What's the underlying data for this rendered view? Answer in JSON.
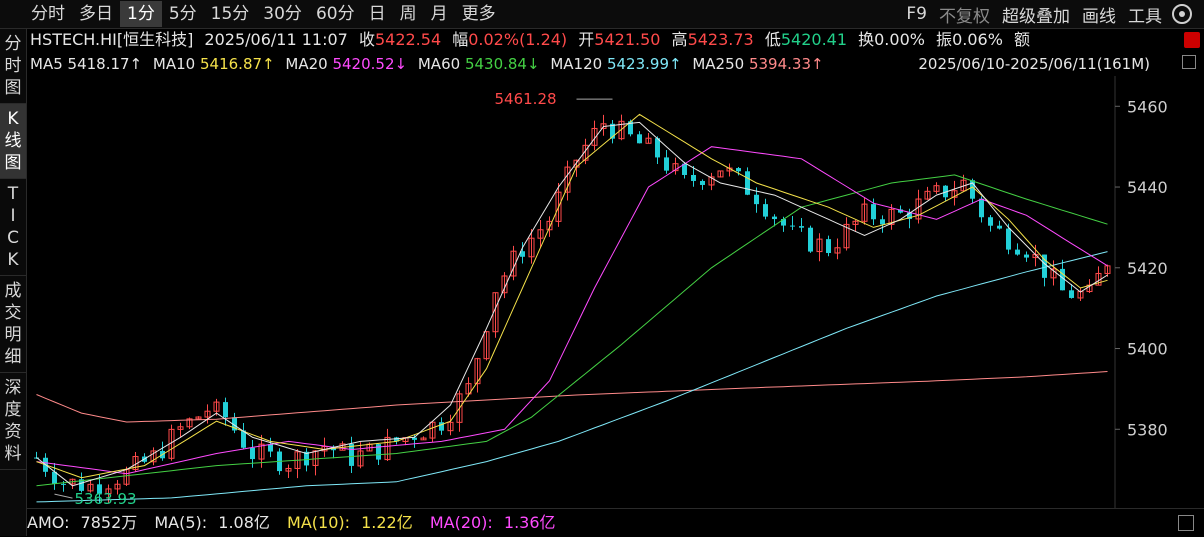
{
  "toolbar": {
    "left": [
      {
        "label": "分时",
        "active": false
      },
      {
        "label": "多日",
        "active": false
      },
      {
        "label": "1分",
        "active": true
      },
      {
        "label": "5分",
        "active": false
      },
      {
        "label": "15分",
        "active": false
      },
      {
        "label": "30分",
        "active": false
      },
      {
        "label": "60分",
        "active": false
      },
      {
        "label": "日",
        "active": false
      },
      {
        "label": "周",
        "active": false
      },
      {
        "label": "月",
        "active": false
      },
      {
        "label": "更多",
        "active": false
      }
    ],
    "right": [
      {
        "label": "F9",
        "dim": false
      },
      {
        "label": "不复权",
        "dim": true
      },
      {
        "label": "超级叠加",
        "dim": false
      },
      {
        "label": "画线",
        "dim": false
      },
      {
        "label": "工具",
        "dim": false
      }
    ]
  },
  "sidebar": [
    "分时图",
    "K线图",
    "TICK",
    "成交明细",
    "深度资料"
  ],
  "header": {
    "symbol": "HSTECH.HI[恒生科技]",
    "datetime": "2025/06/11 11:07",
    "close_label": "收",
    "close": "5422.54",
    "amp_label": "幅",
    "amp": "0.02%(1.24)",
    "open_label": "开",
    "open": "5421.50",
    "high_label": "高",
    "high": "5423.73",
    "low_label": "低",
    "low": "5420.41",
    "turnover_label": "换",
    "turnover": "0.00%",
    "swing_label": "振",
    "swing": "0.06%",
    "amount_label": "额"
  },
  "ma_line": {
    "ma5": "MA5",
    "ma5_val": "5418.17↑",
    "ma10": "MA10",
    "ma10_val": "5416.87↑",
    "ma20": "MA20",
    "ma20_val": "5420.52↓",
    "ma60": "MA60",
    "ma60_val": "5430.84↓",
    "ma120": "MA120",
    "ma120_val": "5423.99↑",
    "ma250": "MA250",
    "ma250_val": "5394.33↑",
    "range": "2025/06/10-2025/06/11(161M)"
  },
  "colors": {
    "up": "#ff4a4a",
    "down": "#22d0d8",
    "ma5": "#e8e8e8",
    "ma10": "#f4e14a",
    "ma20": "#ff4bff",
    "ma60": "#44d044",
    "ma120": "#7fe8f8",
    "ma250": "#ff8a8a"
  },
  "chart_data": {
    "type": "candlestick",
    "y_ticks": [
      "5460",
      "5440",
      "5420",
      "5400",
      "5380"
    ],
    "y_tick_values": [
      5460,
      5440,
      5420,
      5400,
      5380
    ],
    "ylim": [
      5360.5,
      5467.5
    ],
    "max_label": "5461.28",
    "max_value": 5461.28,
    "min_label": "5363.93",
    "min_value": 5363.93,
    "ma_points": {
      "ma250": [
        [
          0,
          5388.6
        ],
        [
          5,
          5384.0
        ],
        [
          10,
          5381.8
        ],
        [
          20,
          5382.5
        ],
        [
          40,
          5386.0
        ],
        [
          60,
          5388.5
        ],
        [
          80,
          5390.3
        ],
        [
          100,
          5392.0
        ],
        [
          110,
          5393.0
        ],
        [
          119,
          5394.3
        ]
      ],
      "ma120": [
        [
          0,
          5362.0
        ],
        [
          15,
          5363.0
        ],
        [
          30,
          5366.0
        ],
        [
          40,
          5367.0
        ],
        [
          50,
          5372.0
        ],
        [
          58,
          5377.0
        ],
        [
          70,
          5387.0
        ],
        [
          80,
          5396.0
        ],
        [
          90,
          5405.0
        ],
        [
          100,
          5413.0
        ],
        [
          110,
          5419.0
        ],
        [
          119,
          5424.0
        ]
      ],
      "ma60": [
        [
          0,
          5366.0
        ],
        [
          20,
          5371.0
        ],
        [
          40,
          5374.0
        ],
        [
          50,
          5377.0
        ],
        [
          55,
          5383.0
        ],
        [
          65,
          5401.0
        ],
        [
          75,
          5420.0
        ],
        [
          85,
          5435.0
        ],
        [
          95,
          5441.0
        ],
        [
          102,
          5443.0
        ],
        [
          110,
          5437.0
        ],
        [
          119,
          5430.8
        ]
      ],
      "ma20": [
        [
          0,
          5372.0
        ],
        [
          10,
          5369.0
        ],
        [
          20,
          5374.0
        ],
        [
          28,
          5377.0
        ],
        [
          35,
          5375.0
        ],
        [
          45,
          5377.0
        ],
        [
          52,
          5380.0
        ],
        [
          57,
          5392.0
        ],
        [
          62,
          5415.0
        ],
        [
          68,
          5440.0
        ],
        [
          75,
          5450.0
        ],
        [
          85,
          5447.0
        ],
        [
          93,
          5436.0
        ],
        [
          100,
          5432.0
        ],
        [
          105,
          5437.0
        ],
        [
          110,
          5433.0
        ],
        [
          115,
          5426.0
        ],
        [
          119,
          5420.5
        ]
      ],
      "ma10": [
        [
          0,
          5372.0
        ],
        [
          5,
          5368.0
        ],
        [
          12,
          5371.0
        ],
        [
          20,
          5382.0
        ],
        [
          26,
          5377.0
        ],
        [
          32,
          5375.0
        ],
        [
          40,
          5377.0
        ],
        [
          46,
          5382.0
        ],
        [
          50,
          5395.0
        ],
        [
          55,
          5420.0
        ],
        [
          60,
          5445.0
        ],
        [
          67,
          5458.0
        ],
        [
          75,
          5447.0
        ],
        [
          80,
          5441.0
        ],
        [
          88,
          5435.0
        ],
        [
          93,
          5430.0
        ],
        [
          98,
          5433.0
        ],
        [
          104,
          5440.0
        ],
        [
          108,
          5432.0
        ],
        [
          112,
          5422.0
        ],
        [
          116,
          5415.0
        ],
        [
          119,
          5416.9
        ]
      ],
      "ma5": [
        [
          0,
          5373.0
        ],
        [
          4,
          5366.0
        ],
        [
          10,
          5370.0
        ],
        [
          16,
          5378.0
        ],
        [
          20,
          5384.0
        ],
        [
          24,
          5378.0
        ],
        [
          30,
          5374.0
        ],
        [
          36,
          5377.0
        ],
        [
          42,
          5378.0
        ],
        [
          46,
          5386.0
        ],
        [
          50,
          5405.0
        ],
        [
          54,
          5425.0
        ],
        [
          58,
          5440.0
        ],
        [
          63,
          5455.0
        ],
        [
          67,
          5456.0
        ],
        [
          72,
          5446.0
        ],
        [
          76,
          5441.0
        ],
        [
          82,
          5438.0
        ],
        [
          88,
          5432.0
        ],
        [
          92,
          5428.0
        ],
        [
          96,
          5432.0
        ],
        [
          100,
          5438.0
        ],
        [
          104,
          5441.0
        ],
        [
          108,
          5430.0
        ],
        [
          112,
          5421.0
        ],
        [
          116,
          5414.0
        ],
        [
          119,
          5418.2
        ]
      ]
    },
    "candles_anchor": [
      [
        0,
        5373
      ],
      [
        3,
        5367
      ],
      [
        6,
        5366
      ],
      [
        10,
        5369
      ],
      [
        13,
        5373
      ],
      [
        16,
        5380
      ],
      [
        19,
        5385
      ],
      [
        21,
        5383
      ],
      [
        24,
        5374
      ],
      [
        28,
        5372
      ],
      [
        32,
        5376
      ],
      [
        35,
        5373
      ],
      [
        38,
        5375
      ],
      [
        41,
        5378
      ],
      [
        45,
        5382
      ],
      [
        48,
        5390
      ],
      [
        51,
        5415
      ],
      [
        54,
        5425
      ],
      [
        57,
        5432
      ],
      [
        60,
        5447
      ],
      [
        63,
        5456
      ],
      [
        66,
        5452
      ],
      [
        69,
        5448
      ],
      [
        72,
        5441
      ],
      [
        76,
        5445
      ],
      [
        80,
        5438
      ],
      [
        84,
        5428
      ],
      [
        88,
        5425
      ],
      [
        92,
        5433
      ],
      [
        96,
        5433
      ],
      [
        100,
        5438
      ],
      [
        103,
        5441
      ],
      [
        106,
        5430
      ],
      [
        110,
        5425
      ],
      [
        114,
        5414
      ],
      [
        117,
        5413
      ],
      [
        119,
        5422
      ]
    ]
  },
  "amo": {
    "amo_label": "AMO:",
    "amo_val": "7852万",
    "ma5_label": "MA(5):",
    "ma5_val": "1.08亿",
    "ma10_label": "MA(10):",
    "ma10_val": "1.22亿",
    "ma20_label": "MA(20):",
    "ma20_val": "1.36亿"
  }
}
